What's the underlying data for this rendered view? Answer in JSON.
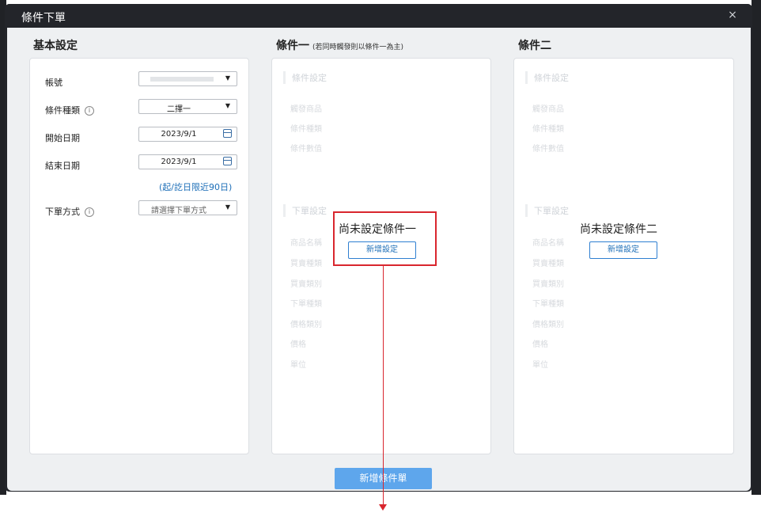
{
  "dialog": {
    "title": "條件下單",
    "close_symbol": "×"
  },
  "basic": {
    "heading": "基本設定",
    "account_label": "帳號",
    "type_label": "條件種類",
    "type_value": "二擇一",
    "start_label": "開始日期",
    "start_value": "2023/9/1",
    "end_label": "結束日期",
    "end_value": "2023/9/1",
    "range_note": "(起/訖日限近90日)",
    "order_label": "下單方式",
    "order_placeholder": "請選擇下單方式",
    "info_symbol": "i",
    "dropdown_symbol": "▼"
  },
  "condition1": {
    "heading": "條件一",
    "note": "(若同時觸發則以條件一為主)",
    "section_condition": "條件設定",
    "fields_condition": [
      "觸發商品",
      "條件種類",
      "條件數值"
    ],
    "section_order": "下單設定",
    "fields_order": [
      "商品名稱",
      "買賣種類",
      "買賣類別",
      "下單種類",
      "價格類別",
      "價格",
      "單位"
    ],
    "empty_message": "尚未設定條件一",
    "add_label": "新增設定"
  },
  "condition2": {
    "heading": "條件二",
    "section_condition": "條件設定",
    "fields_condition": [
      "觸發商品",
      "條件種類",
      "條件數值"
    ],
    "section_order": "下單設定",
    "fields_order": [
      "商品名稱",
      "買賣種類",
      "買賣類別",
      "下單種類",
      "價格類別",
      "價格",
      "單位"
    ],
    "empty_message": "尚未設定條件二",
    "add_label": "新增設定"
  },
  "footer": {
    "submit_label": "新增條件單"
  },
  "colors": {
    "accent": "#2f7fd1",
    "submit_bg": "#5ea6ec",
    "highlight": "#d9262e",
    "titlebar": "#23252a",
    "content_bg": "#eef0f2"
  },
  "icons": {
    "info": "info-icon",
    "calendar": "calendar-icon",
    "dropdown": "chevron-down-icon",
    "close": "close-icon"
  }
}
